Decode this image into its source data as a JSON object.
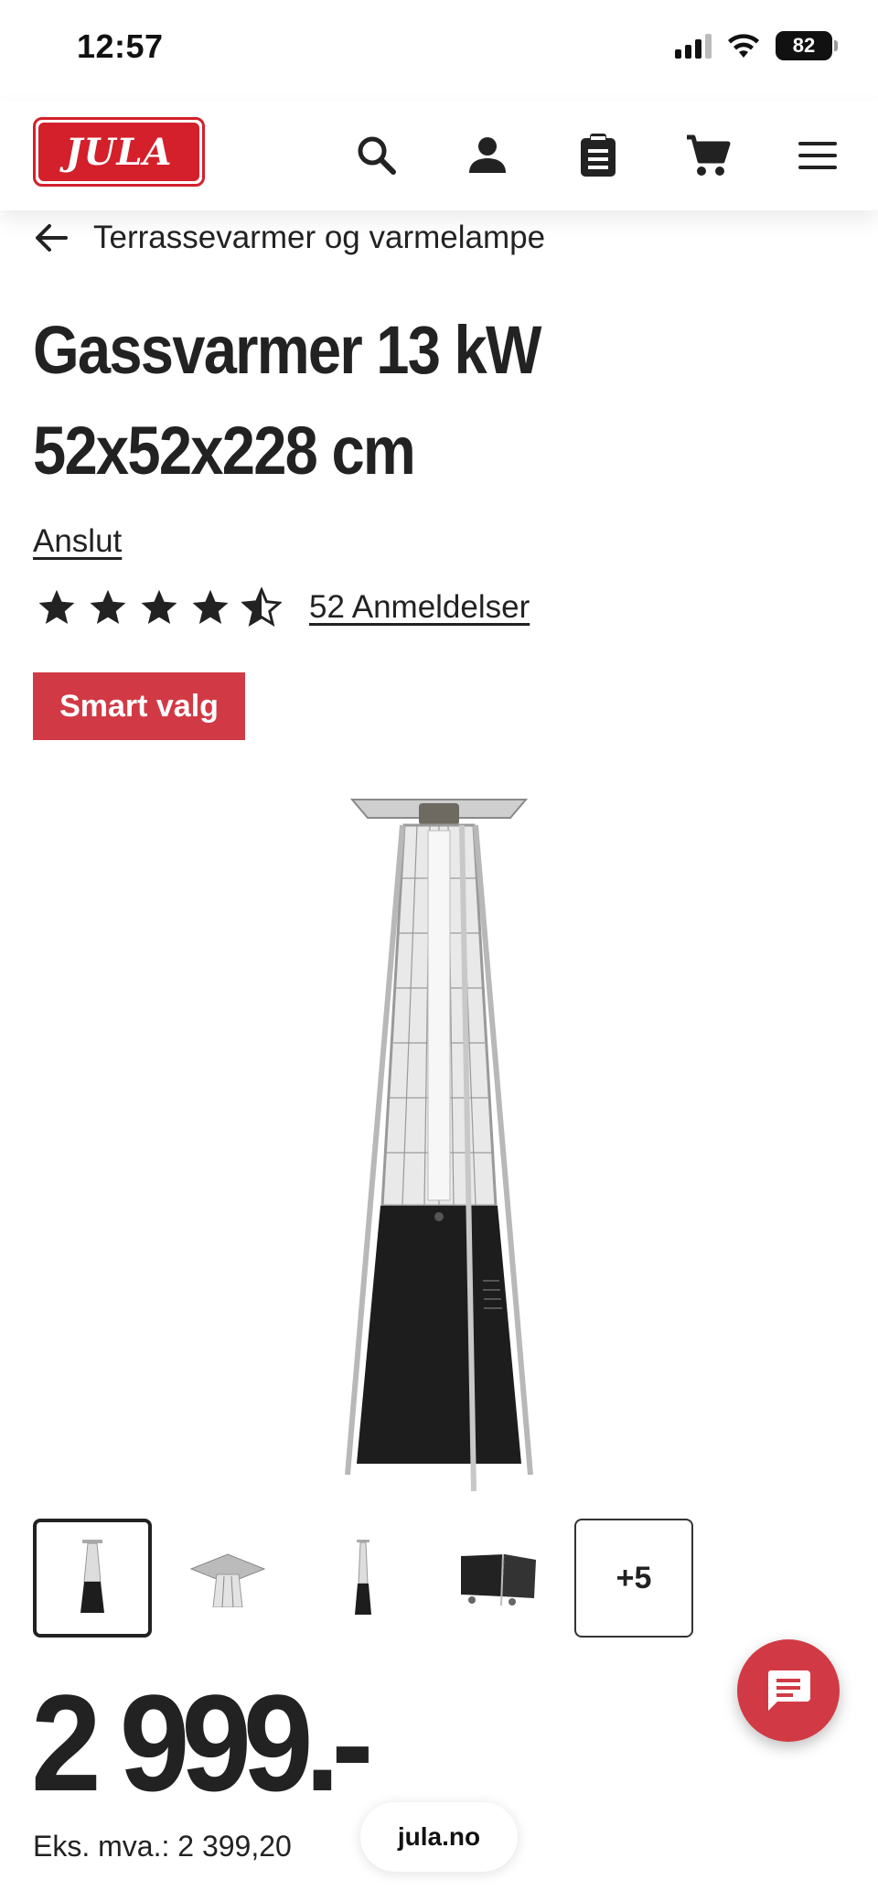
{
  "status_bar": {
    "time": "12:57",
    "battery": "82"
  },
  "header": {
    "logo_text": "JULA",
    "icons": [
      "search-icon",
      "account-icon",
      "shopping-list-icon",
      "cart-icon",
      "menu-icon"
    ]
  },
  "breadcrumb": {
    "label": "Terrassevarmer og varmelampe"
  },
  "product": {
    "title_line1": "Gassvarmer 13 kW",
    "title_line2": "52x52x228 cm",
    "brand": "Anslut",
    "rating": 4.5,
    "reviews": "52 Anmeldelser",
    "badge": "Smart valg",
    "more_images": "+5",
    "price": "2 999.-",
    "price_ex_vat": "Eks. mva.: 2 399,20"
  },
  "browser": {
    "url": "jula.no"
  },
  "colors": {
    "brand_red": "#d4202b",
    "badge_red": "#d13a45",
    "text": "#222222"
  }
}
